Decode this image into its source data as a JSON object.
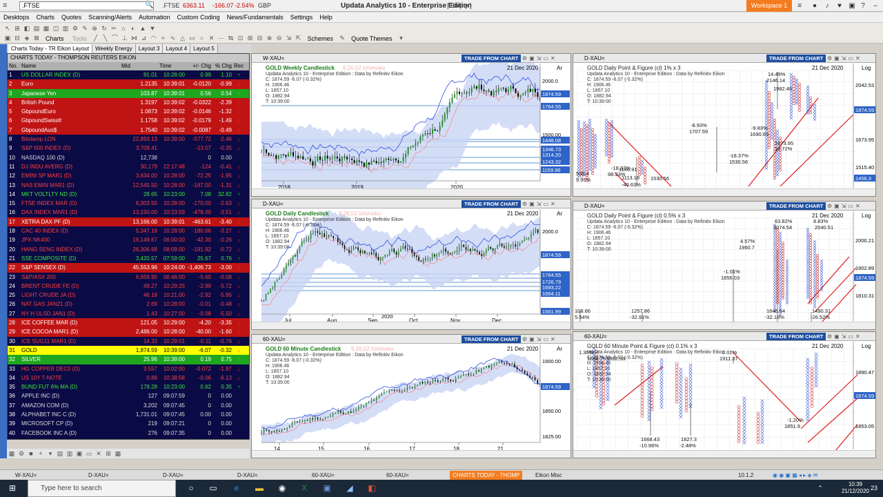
{
  "titlebar": {
    "symbol_input": ".FTSE",
    "ticker": ".FTSE",
    "ticker_value": "6363.11",
    "ticker_change": "-166.07",
    "ticker_pct": "-2.54%",
    "ticker_ccy": "GBP",
    "app_title": "Updata Analytics 10 - Enterprise Edition",
    "app_state": "[ Empty ]",
    "workspace": "Workspace 1"
  },
  "menu": [
    "Desktops",
    "Charts",
    "Quotes",
    "Scanning/Alerts",
    "Automation",
    "Custom Coding",
    "News/Fundamentals",
    "Settings",
    "Help"
  ],
  "toolbar": {
    "charts_label": "Charts",
    "tools_label": "Tools",
    "schemes_label": "Schemes",
    "quote_themes_label": "Quote Themes"
  },
  "layout_tabs": [
    "Charts Today - TR Eikon Layout",
    "Weekly Energy",
    "Layout 3",
    "Layout 4",
    "Layout 5"
  ],
  "quote_list": {
    "title": "CHARTS TODAY - THOMPSON REUTERS EIKON",
    "columns": [
      "No.",
      "Name",
      "Mid",
      "Time",
      "+/- Chg",
      "% Chg",
      "Rec"
    ],
    "rows": [
      {
        "no": "1",
        "name": "US DOLLAR INDEX (D)",
        "mid": "91.01",
        "time": "10:28:00",
        "chg": "0.99",
        "pct": "1.10"
      },
      {
        "no": "2",
        "name": "Euro",
        "mid": "1.2135",
        "time": "10:39:01",
        "chg": "-0.0120",
        "pct": "-0.99"
      },
      {
        "no": "3",
        "name": "Japanese Yen",
        "mid": "103.87",
        "time": "10:39:01",
        "chg": "0.56",
        "pct": "0.54"
      },
      {
        "no": "4",
        "name": "British Pound",
        "mid": "1.3197",
        "time": "10:39:02",
        "chg": "-0.0322",
        "pct": "-2.39"
      },
      {
        "no": "5",
        "name": "GbpoundEuro",
        "mid": "1.0873",
        "time": "10:39:02",
        "chg": "-0.0146",
        "pct": "-1.32"
      },
      {
        "no": "6",
        "name": "GbpoundSwissfr",
        "mid": "1.1758",
        "time": "10:39:02",
        "chg": "-0.0179",
        "pct": "-1.49"
      },
      {
        "no": "7",
        "name": "GbpoundAus$",
        "mid": "1.7540",
        "time": "10:39:02",
        "chg": "-0.0087",
        "pct": "-0.49"
      },
      {
        "no": "8",
        "name": "Bitstamp      LON",
        "mid": "22,893.13",
        "time": "10:39:00",
        "chg": "-577.72",
        "pct": "-2.46"
      },
      {
        "no": "9",
        "name": "S&P 500 INDEX (D)",
        "mid": "3,709.41",
        "time": "",
        "chg": "-13.07",
        "pct": "-0.35"
      },
      {
        "no": "10",
        "name": "NASDAQ 100 (D)",
        "mid": "12,738",
        "time": "",
        "chg": "0",
        "pct": "0.00"
      },
      {
        "no": "11",
        "name": "DJ INDU AVERG (D)",
        "mid": "30,179",
        "time": "22:17:48",
        "chg": "-124",
        "pct": "-0.41"
      },
      {
        "no": "12",
        "name": "EMINI SP MAR1 (D)",
        "mid": "3,634.00",
        "time": "10:28:00",
        "chg": "-72.25",
        "pct": "-1.95"
      },
      {
        "no": "13",
        "name": "NAS EMIN MAR1 (D)",
        "mid": "12,545.50",
        "time": "10:28:00",
        "chg": "-167.00",
        "pct": "-1.31"
      },
      {
        "no": "14",
        "name": "MKT VOLTLTY ND (D)",
        "mid": "28.65",
        "time": "10:23:00",
        "chg": "7.08",
        "pct": "32.82"
      },
      {
        "no": "15",
        "name": "FTSE INDEX MAR (D)",
        "mid": "6,303.50",
        "time": "10:28:00",
        "chg": "-170.00",
        "pct": "-2.63"
      },
      {
        "no": "16",
        "name": "DAX INDEX MAR1 (D)",
        "mid": "13,150.00",
        "time": "10:23:59",
        "chg": "-478.00",
        "pct": "-3.51"
      },
      {
        "no": "17",
        "name": "XETRA DAX PF (D)",
        "mid": "13,166.00",
        "time": "10:39:01",
        "chg": "-463.61",
        "pct": "-3.40"
      },
      {
        "no": "18",
        "name": "CAC 40 INDEX (D)",
        "mid": "5,347.18",
        "time": "10:28:00",
        "chg": "-180.66",
        "pct": "-3.27"
      },
      {
        "no": "19",
        "name": "JPX NK400",
        "mid": "16,149.67",
        "time": "06:00:00",
        "chg": "-42.30",
        "pct": "-0.26"
      },
      {
        "no": "20",
        "name": "HANG SENG INDEX (D)",
        "mid": "26,306.68",
        "time": "08:09:00",
        "chg": "-191.92",
        "pct": "-0.72"
      },
      {
        "no": "21",
        "name": "SSE COMPOSITE (D)",
        "mid": "3,420.57",
        "time": "07:59:00",
        "chg": "25.67",
        "pct": "0.76"
      },
      {
        "no": "22",
        "name": "S&P SENSEX (D)",
        "mid": "45,553.96",
        "time": "10:24:00",
        "chg": "-1,406.73",
        "pct": "-3.00"
      },
      {
        "no": "23",
        "name": "S&P/ASX 200",
        "mid": "6,659.90",
        "time": "06:46:00",
        "chg": "-5.60",
        "pct": "-0.08"
      },
      {
        "no": "24",
        "name": "BRENT CRUDE FE (D)",
        "mid": "49.27",
        "time": "10:29:25",
        "chg": "-2.99",
        "pct": "-5.72"
      },
      {
        "no": "25",
        "name": "LIGHT CRUDE JA (D)",
        "mid": "46.18",
        "time": "10:21:00",
        "chg": "-2.92",
        "pct": "-5.95"
      },
      {
        "no": "26",
        "name": "NAT GAS JAN21 (D)",
        "mid": "2.69",
        "time": "10:28:00",
        "chg": "-0.01",
        "pct": "-0.48"
      },
      {
        "no": "27",
        "name": "NY H ULSD JAN1 (D)",
        "mid": "1.43",
        "time": "10:27:00",
        "chg": "-0.08",
        "pct": "-5.50"
      },
      {
        "no": "28",
        "name": "ICE COFFEE MAR (D)",
        "mid": "121.05",
        "time": "10:29:00",
        "chg": "-4.20",
        "pct": "-3.35"
      },
      {
        "no": "29",
        "name": "ICE COCOA MAR1 (D)",
        "mid": "2,486.00",
        "time": "10:28:00",
        "chg": "-40.00",
        "pct": "-1.60"
      },
      {
        "no": "30",
        "name": "ICE SUG11 MAR1 (D)",
        "mid": "14.33",
        "time": "10:29:01",
        "chg": "-0.11",
        "pct": "-0.76"
      },
      {
        "no": "31",
        "name": "GOLD",
        "mid": "1,874.59",
        "time": "10:39:00",
        "chg": "-6.07",
        "pct": "-0.32"
      },
      {
        "no": "32",
        "name": "SILVER",
        "mid": "25.96",
        "time": "10:39:00",
        "chg": "0.19",
        "pct": "0.75"
      },
      {
        "no": "33",
        "name": "HG COPPER DEC0 (D)",
        "mid": "3.557",
        "time": "10:02:00",
        "chg": "-0.072",
        "pct": "-1.97"
      },
      {
        "no": "34",
        "name": "US 10Y T-NOTE",
        "mid": "0.89",
        "time": "10:38:58",
        "chg": "-0.06",
        "pct": "-6.13"
      },
      {
        "no": "35",
        "name": "BUND FUT 6% MA (D)",
        "mid": "178.28",
        "time": "10:23:00",
        "chg": "0.62",
        "pct": "0.35"
      },
      {
        "no": "36",
        "name": "APPLE INC (D)",
        "mid": "127",
        "time": "09:07:59",
        "chg": "0",
        "pct": "0.00"
      },
      {
        "no": "37",
        "name": "AMAZON COM (D)",
        "mid": "3,202",
        "time": "09:07:45",
        "chg": "0",
        "pct": "0.00"
      },
      {
        "no": "38",
        "name": "ALPHABET INC C (D)",
        "mid": "1,731.01",
        "time": "09:07:45",
        "chg": "0.00",
        "pct": "0.00"
      },
      {
        "no": "39",
        "name": "MICROSOFT CP (D)",
        "mid": "219",
        "time": "09:07:21",
        "chg": "0",
        "pct": "0.00"
      },
      {
        "no": "40",
        "name": "FACEBOOK INC A (D)",
        "mid": "276",
        "time": "09:07:35",
        "chg": "0",
        "pct": "0.00"
      }
    ]
  },
  "colors": {
    "up": "#12a812",
    "down": "#c81010",
    "bull_bg": "#1fa61f",
    "bear_bg": "#c01414",
    "gold_bg": "#ffff00",
    "tfc": "#1e4fa0",
    "accent": "#f47c20"
  },
  "panels": {
    "w_xau": {
      "tab": "W-XAU=",
      "label": "GOLD Weekly Candlestick",
      "study": "9,26,52 Ichimoku",
      "meta": [
        "Updata Analytics 10 - Enterprise Edition : Data by Refinitiv Eikon",
        "C: 1874.59 -6.07 (-0.32%)",
        "H: 1906.46",
        "L: 1857.10",
        "O: 1882.94",
        "T: 10:39:00"
      ],
      "date": "21 Dec 2020",
      "scale": "Ar",
      "y_ticks": [
        "2000.0",
        "1874.59",
        "1764.55",
        "1500.00",
        "1448.08",
        "1346.73",
        "1314.20",
        "1243.32",
        "1159.96"
      ],
      "x_ticks": [
        "2018",
        "2019",
        "2020"
      ]
    },
    "d_xau_candle": {
      "tab": "D-XAU=",
      "label": "GOLD Daily Candlestick",
      "study": "9,26,52 Ichimoku",
      "meta": [
        "Updata Analytics 10 - Enterprise Edition : Data by Refinitiv Eikon",
        "C: 1874.59 -6.07 (-0.32%)",
        "H: 1906.46",
        "L: 1857.10",
        "O: 1882.94",
        "T: 10:39:00"
      ],
      "date": "21 Dec 2020",
      "scale": "Ar",
      "y_ticks": [
        "2000.0",
        "1874.59",
        "1764.55",
        "1726.79",
        "1693.22",
        "1664.11",
        "1561.99"
      ],
      "x_ticks": [
        "Jul",
        "Aug",
        "Sep",
        "Oct",
        "Nov",
        "Dec"
      ],
      "year": "2020"
    },
    "m60_xau": {
      "tab": "60-XAU=",
      "label": "GOLD 60 Minute Candlestick",
      "study": "9,26,52 Ichimoku",
      "meta": [
        "Updata Analytics 10 - Enterprise Edition : Data by Refinitiv Eikon",
        "C: 1874.59 -6.07 (-0.32%)",
        "H: 1906.46",
        "L: 1857.10",
        "O: 1882.94",
        "T: 10:39:00"
      ],
      "date": "21 Dec 2020",
      "scale": "Ar",
      "y_ticks": [
        "1900.00",
        "1874.59",
        "1850.00",
        "1825.00"
      ],
      "x_ticks": [
        "14",
        "15",
        "16",
        "17",
        "18",
        "21"
      ]
    },
    "d_pf1": {
      "tab": "D-XAU=",
      "label": "GOLD Daily Point & Figure (cl) 1% x 3",
      "meta": [
        "Updata Analytics 10 - Enterprise Edition : Data by Refinitiv Eikon",
        "C: 1874.59 -6.07 (-0.32%)",
        "H: 1906.46",
        "L: 1857.10",
        "O: 1882.94",
        "T: 10:39:00"
      ],
      "date": "21 Dec 2020",
      "scale": "Log",
      "y_ticks": [
        "2042.53",
        "1874.59",
        "1673.95",
        "1515.40",
        "1456.3"
      ],
      "annots": [
        "14.49%",
        "2146.14",
        "1982.46",
        "-8.93%",
        "1707.59",
        "-9.83%",
        "1690.69",
        "1673.95",
        "10.72%",
        "-18.37%",
        "1530.56",
        "500.4",
        "9.95%",
        "1146.91",
        "1113.18",
        "1530.56",
        "-18.37%",
        "98.33%",
        "-40.63%"
      ]
    },
    "d_pf05": {
      "tab": "D-XAU=",
      "label": "GOLD Daily Point & Figure (cl) 0.5% x 3",
      "meta": [
        "Updata Analytics 10 - Enterprise Edition : Data by Refinitiv Eikon",
        "C: 1874.59 -6.07 (-0.32%)",
        "H: 1906.46",
        "L: 1857.10",
        "O: 1882.94",
        "T: 10:39:00"
      ],
      "date": "21 Dec 2020",
      "scale": "Log",
      "y_ticks": [
        "2000.21",
        "1902.89",
        "1874.59",
        "1810.31"
      ],
      "annots": [
        "63.82%",
        "3074.54",
        "8.83%",
        "2040.51",
        "4.57%",
        "1960.7",
        "-1.01%",
        "1856.03",
        "108.66",
        "5.54%",
        "1257.86",
        "-32.91%",
        "1646.64",
        "-32.18%",
        "1490.31",
        "-26.52%"
      ]
    },
    "m60_pf": {
      "tab": "60-XAU=",
      "label": "GOLD 60 Minute Point & Figure (cl) 0.1% x 3",
      "meta": [
        "Updata Analytics 10 - Enterprise Edition : Data by Refinitiv Eikon",
        "C: 1874.59 -6.07 (-0.32%)",
        "H: 1906.46",
        "L: 1857.10",
        "O: 1882.94",
        "T: 10:39:00"
      ],
      "date": "21 Dec 2020",
      "scale": "Log",
      "y_ticks": [
        "1890.47",
        "1874.59",
        "1853.05"
      ],
      "annots": [
        "1.30%",
        "1868.76",
        "1862.98",
        "2.01%",
        "1911.37",
        "-1.20%",
        "1851.9",
        "1668.43",
        "-10.96%",
        "1827.3",
        "-2.48%"
      ]
    }
  },
  "tfc_label": "TRADE FROM CHART",
  "bottom_tabs": [
    "W-XAU=",
    "D-XAU=",
    "D-XAU=",
    "D-XAU=",
    "60-XAU=",
    "60-XAU=",
    "CHARTS TODAY - THOMP",
    "Eikon Misc"
  ],
  "taskbar": {
    "search_placeholder": "Type here to search",
    "version": "10.1.2",
    "time": "10:39",
    "date": "21/12/2020",
    "notif": "23"
  }
}
